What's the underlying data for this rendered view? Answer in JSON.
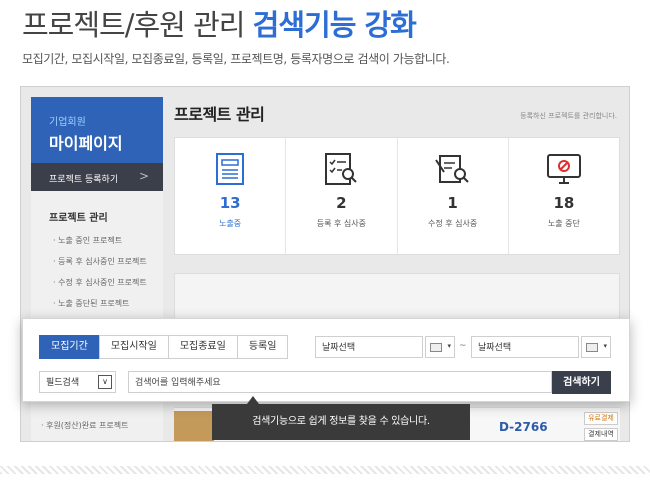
{
  "headline": {
    "plain": "프로젝트/후원 관리",
    "accent": "검색기능 강화"
  },
  "subline": "모집기간, 모집시작일, 모집종료일, 등록일, 프로젝트명, 등록자명으로 검색이 가능합니다.",
  "sidebar": {
    "member_type": "기업회원",
    "title": "마이페이지",
    "register_label": "프로젝트 등록하기",
    "section_title": "프로젝트 관리",
    "items": [
      "· 노출 중인 프로젝트",
      "· 등록 후 심사중인 프로젝트",
      "· 수정 후 심사중인 프로젝트",
      "· 노출 중단된 프로젝트"
    ],
    "bottom_item": "· 후원(정산)완료 프로젝트"
  },
  "main": {
    "title": "프로젝트 관리",
    "note": "등록하신 프로젝트를 관리합니다.",
    "stats": [
      {
        "count": "13",
        "label": "노출중",
        "icon": "document-list-icon"
      },
      {
        "count": "2",
        "label": "등록 후 심사중",
        "icon": "checklist-search-icon"
      },
      {
        "count": "1",
        "label": "수정 후 심사중",
        "icon": "edit-search-icon"
      },
      {
        "count": "18",
        "label": "노출 중단",
        "icon": "monitor-block-icon"
      }
    ],
    "list_code": "D-2766",
    "btn_payment": "유료결제",
    "btn_history": "결제내역"
  },
  "search": {
    "tabs": [
      "모집기간",
      "모집시작일",
      "모집종료일",
      "등록일"
    ],
    "active_tab": 0,
    "date_from": "날짜선택",
    "date_to": "날짜선택",
    "tilde": "~",
    "field_label": "필드검색",
    "input_placeholder": "검색어를 입력해주세요",
    "submit_label": "검색하기"
  },
  "tooltip": "검색기능으로 쉽게 정보를 찾을 수 있습니다.",
  "colors": {
    "accent": "#2d6ed4",
    "sidebar": "#2f63b8",
    "dark": "#3a3f4c"
  }
}
